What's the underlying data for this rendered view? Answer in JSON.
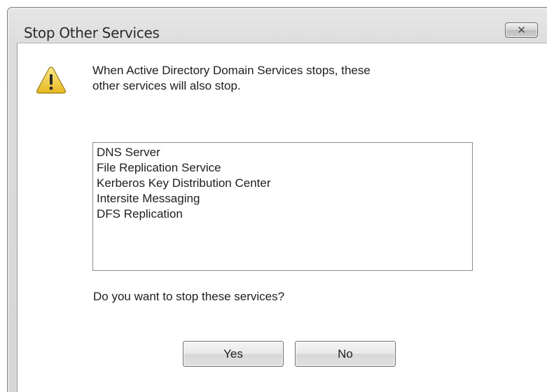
{
  "window": {
    "title": "Stop Other Services"
  },
  "close_button": {
    "icon": "close-icon",
    "glyph": "✕"
  },
  "dialog": {
    "icon": "warning-icon",
    "message": "When Active Directory Domain Services stops, these other services will also stop.",
    "message_line1": "When Active Directory Domain Services stops, these",
    "message_line2": "other services will also stop.",
    "services": [
      "DNS Server",
      "File Replication Service",
      "Kerberos Key Distribution Center",
      "Intersite Messaging",
      "DFS Replication"
    ],
    "question": "Do you want to stop these services?",
    "yes_label": "Yes",
    "no_label": "No"
  },
  "colors": {
    "window_frame": "#d6d6d6",
    "client_background": "#ffffff",
    "warning_yellow": "#f2d23a"
  }
}
